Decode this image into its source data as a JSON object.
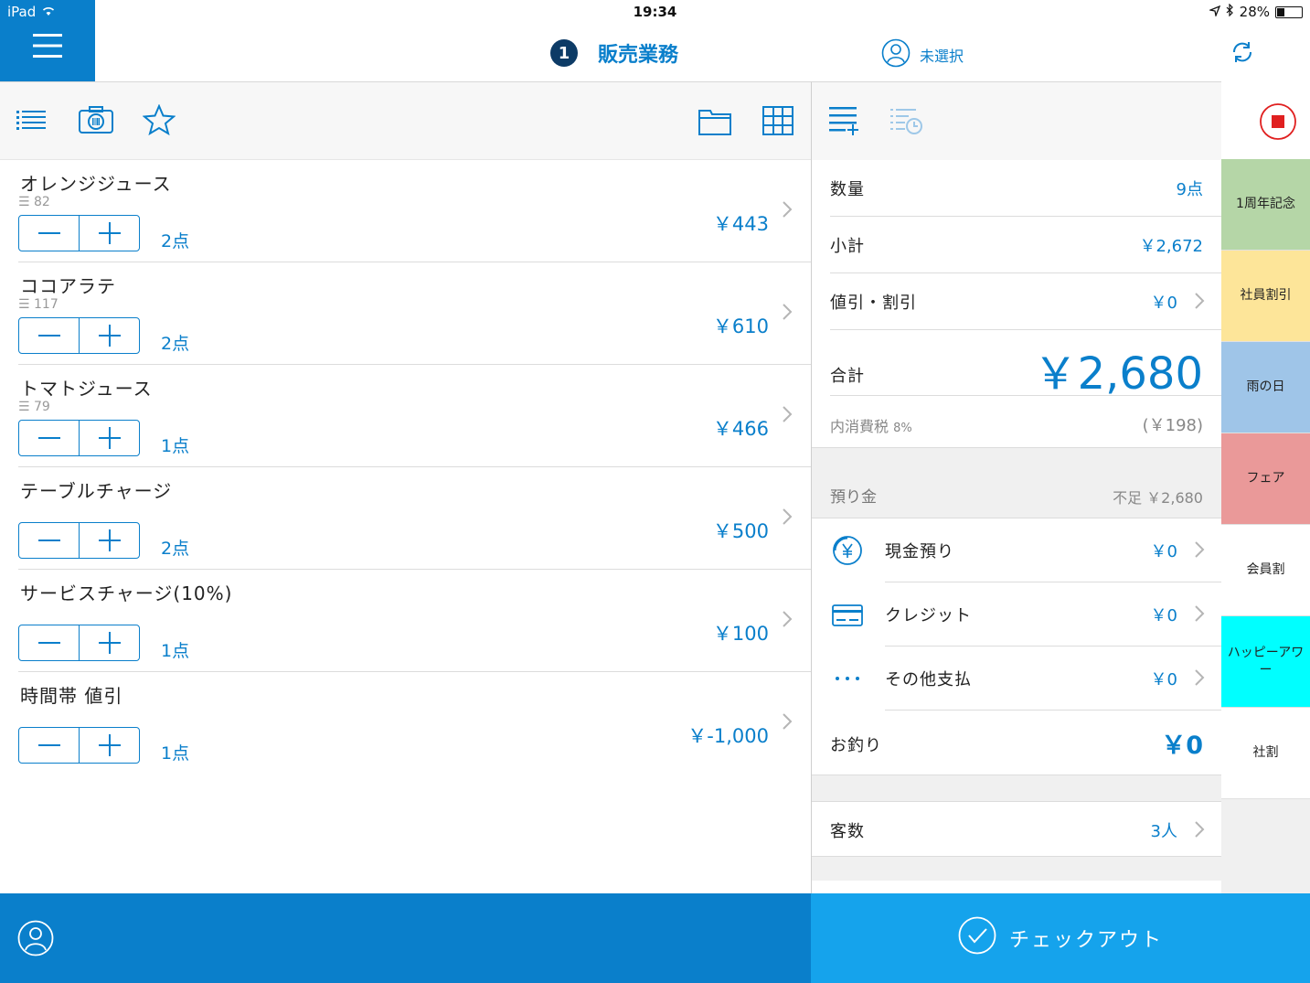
{
  "status_bar": {
    "device": "iPad",
    "time": "19:34",
    "battery": "28%",
    "battery_level": 0.28
  },
  "header": {
    "register_number": "1",
    "title": "販売業務",
    "customer": "未選択"
  },
  "items": [
    {
      "name": "オレンジジュース",
      "stock": "82",
      "qty": "2点",
      "price": "￥443"
    },
    {
      "name": "ココアラテ",
      "stock": "117",
      "qty": "2点",
      "price": "￥610"
    },
    {
      "name": "トマトジュース",
      "stock": "79",
      "qty": "1点",
      "price": "￥466"
    },
    {
      "name": "テーブルチャージ",
      "stock": "",
      "qty": "2点",
      "price": "￥500"
    },
    {
      "name": "サービスチャージ(10%)",
      "stock": "",
      "qty": "1点",
      "price": "￥100"
    },
    {
      "name": "時間帯 値引",
      "stock": "",
      "qty": "1点",
      "price": "￥-1,000"
    }
  ],
  "summary": {
    "quantity_label": "数量",
    "quantity": "9点",
    "subtotal_label": "小計",
    "subtotal": "￥2,672",
    "discount_label": "値引・割引",
    "discount": "￥0",
    "total_label": "合計",
    "total": "￥2,680",
    "tax_label": "内消費税",
    "tax_rate": "8%",
    "tax": "(￥198)"
  },
  "deposit": {
    "label": "預り金",
    "shortage": "不足 ￥2,680",
    "methods": [
      {
        "icon": "yen-coin-icon",
        "label": "現金預り",
        "value": "￥0"
      },
      {
        "icon": "credit-card-icon",
        "label": "クレジット",
        "value": "￥0"
      },
      {
        "icon": "more-dots-icon",
        "label": "その他支払",
        "value": "￥0"
      }
    ],
    "change_label": "お釣り",
    "change": "￥0"
  },
  "guests": {
    "label": "客数",
    "value": "3人"
  },
  "discounts": [
    {
      "label": "1周年記念",
      "color": "#b5d6a7"
    },
    {
      "label": "社員割引",
      "color": "#fde599"
    },
    {
      "label": "雨の日",
      "color": "#9fc5e8"
    },
    {
      "label": "フェア",
      "color": "#ea9999"
    },
    {
      "label": "会員割",
      "color": "#ffffff"
    },
    {
      "label": "ハッピーアワー",
      "color": "#00ffff"
    },
    {
      "label": "社割",
      "color": "#ffffff"
    }
  ],
  "checkout": {
    "label": "チェックアウト"
  },
  "colors": {
    "accent": "#0a7fcb",
    "checkout": "#15a3ec",
    "stop": "#e02020"
  }
}
